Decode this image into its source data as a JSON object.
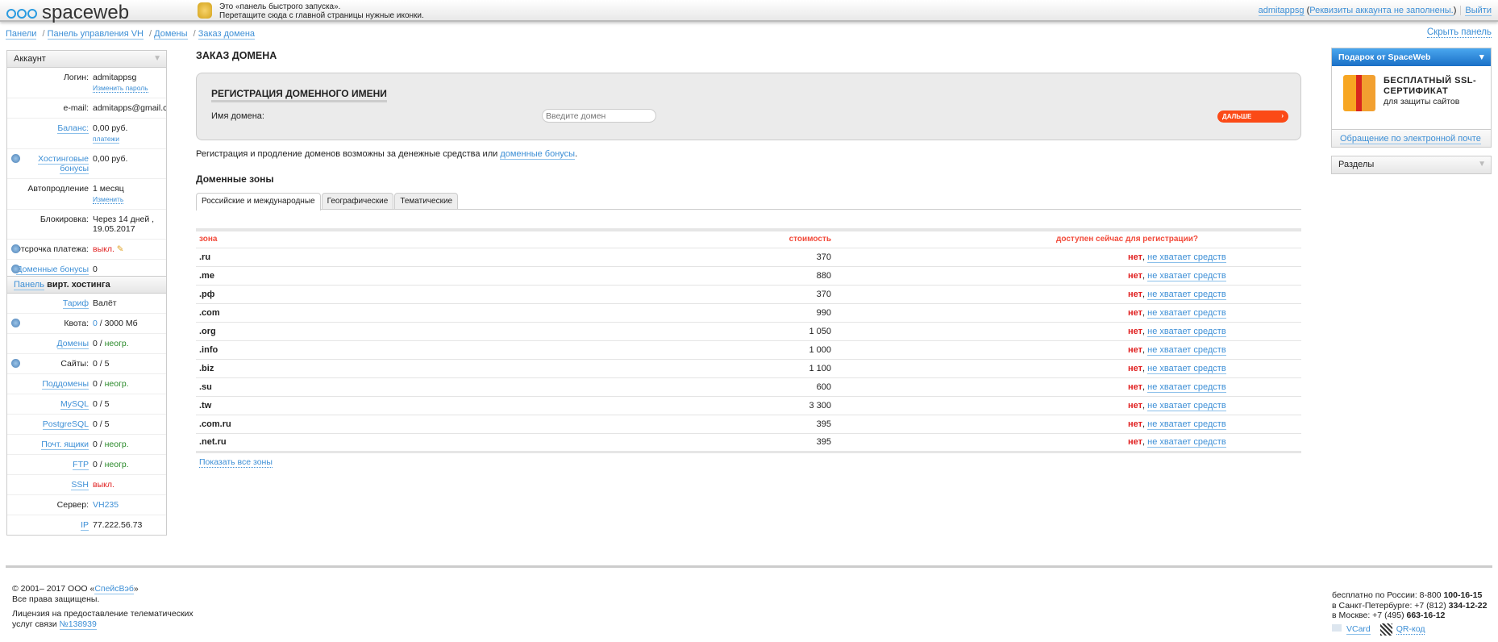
{
  "header": {
    "logo": "spaceweb",
    "quick_launch": [
      "Это «панель быстрого запуска».",
      "Перетащите сюда с главной страницы нужные иконки."
    ],
    "user": "admitappsg",
    "account_note": "Реквизиты аккаунта не заполнены.",
    "logout": "Выйти"
  },
  "breadcrumb": [
    "Панели",
    "Панель управления VH",
    "Домены",
    "Заказ домена"
  ],
  "hide_panel": "Скрыть панель",
  "account": {
    "title": "Аккаунт",
    "rows": [
      {
        "k": "Логин:",
        "v": "admitappsg",
        "sub": "Изменить пароль"
      },
      {
        "k": "e-mail:",
        "v": "admitapps@gmail.com"
      },
      {
        "k": "Баланс:",
        "v": "0,00 руб.",
        "sub": "платежи",
        "link": true
      },
      {
        "k": "Хостинговые бонусы",
        "v": "0,00 руб.",
        "link": true,
        "q": true
      },
      {
        "k": "Автопродление",
        "v": "1 месяц",
        "sub": "Изменить"
      },
      {
        "k": "Блокировка:",
        "v": "Через 14 дней ,",
        "v2": "19.05.2017"
      },
      {
        "k": "Отсрочка платежа:",
        "v": "выкл.",
        "red": true,
        "q": true
      },
      {
        "k": "Доменные бонусы",
        "v": "0",
        "link": true,
        "q": true
      }
    ]
  },
  "hosting": {
    "title_link": "Панель",
    "title": "вирт. хостинга",
    "rows": [
      {
        "k": "Тариф",
        "v": "Валёт",
        "link": true
      },
      {
        "k": "Квота:",
        "v0": "0",
        "v": " / 3000 Мб",
        "q": true
      },
      {
        "k": "Домены",
        "v": "0 / ",
        "g": "неогр.",
        "link": true
      },
      {
        "k": "Сайты:",
        "v": "0 / 5",
        "q": true
      },
      {
        "k": "Поддомены",
        "v": "0 / ",
        "g": "неогр.",
        "link": true
      },
      {
        "k": "MySQL",
        "v": "0 / 5",
        "link": true
      },
      {
        "k": "PostgreSQL",
        "v": "0 / 5",
        "link": true
      },
      {
        "k": "Почт. ящики",
        "v": "0 / ",
        "g": "неогр.",
        "link": true
      },
      {
        "k": "FTP",
        "v": "0 / ",
        "g": "неогр.",
        "link": true
      },
      {
        "k": "SSH",
        "v": "выкл.",
        "red": true,
        "link": true
      },
      {
        "k": "Сервер:",
        "v0": "VH235"
      },
      {
        "k": "IP",
        "v": "77.222.56.73",
        "link": true
      }
    ]
  },
  "main": {
    "title": "ЗАКАЗ ДОМЕНА",
    "reg_title": "РЕГИСТРАЦИЯ ДОМЕННОГО ИМЕНИ",
    "domain_label": "Имя домена:",
    "domain_placeholder": "Введите домен",
    "next_button": "ДАЛЬШЕ",
    "note": "Регистрация и продление доменов возможны за денежные средства или ",
    "note_link": "доменные бонусы",
    "zones_title": "Доменные зоны",
    "tabs": [
      "Российские и международные",
      "Географические",
      "Тематические"
    ],
    "columns": [
      "зона",
      "стоимость",
      "доступен сейчас для регистрации?"
    ],
    "no": "нет",
    "no_funds": "не хватает средств",
    "zones": [
      [
        ".ru",
        "370"
      ],
      [
        ".me",
        "880"
      ],
      [
        ".рф",
        "370"
      ],
      [
        ".com",
        "990"
      ],
      [
        ".org",
        "1 050"
      ],
      [
        ".info",
        "1 000"
      ],
      [
        ".biz",
        "1 100"
      ],
      [
        ".su",
        "600"
      ],
      [
        ".tw",
        "3 300"
      ],
      [
        ".com.ru",
        "395"
      ],
      [
        ".net.ru",
        "395"
      ]
    ],
    "show_all": "Показать все зоны"
  },
  "right": {
    "gift_title": "Подарок от SpaceWeb",
    "gift_text1": "БЕСПЛАТНЫЙ SSL-",
    "gift_text2": "СЕРТИФИКАТ",
    "gift_sub": "для защиты сайтов",
    "email_support": "Обращение по электронной почте",
    "sections": "Разделы"
  },
  "footer": {
    "copy": "© 2001– 2017 ООО «",
    "company": "СпейсВэб",
    "rights": "Все права защищены.",
    "license": "Лицензия на предоставление телематических",
    "license2": "услуг связи ",
    "license_no": "№138939",
    "phones": [
      [
        "бесплатно по России: 8-800 ",
        "100-16-15"
      ],
      [
        "в Санкт-Петербурге: +7 (812) ",
        "334-12-22"
      ],
      [
        "в Москве: +7 (495) ",
        "663-16-12"
      ]
    ],
    "vcard": "VCard",
    "qr": "QR-код"
  },
  "colors": {
    "accent": "#3d8fd6",
    "next": "#fb4a17",
    "table_head": "#f24a3a"
  }
}
